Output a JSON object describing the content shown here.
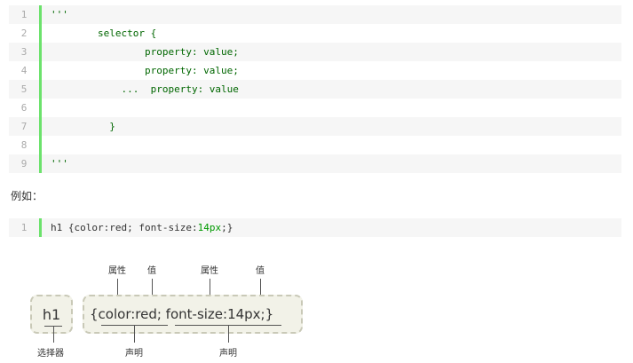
{
  "code_block_1": {
    "lines": [
      {
        "num": "1",
        "text": "'''"
      },
      {
        "num": "2",
        "text": "        selector {"
      },
      {
        "num": "3",
        "text": "                property: value;"
      },
      {
        "num": "4",
        "text": "                property: value;"
      },
      {
        "num": "5",
        "text": "            ...  property: value"
      },
      {
        "num": "6",
        "text": ""
      },
      {
        "num": "7",
        "text": "          }"
      },
      {
        "num": "8",
        "text": ""
      },
      {
        "num": "9",
        "text": "'''"
      }
    ]
  },
  "example_label": "例如：",
  "code_block_2": {
    "line_num": "1",
    "prefix": "h1 {color:red; font-size:",
    "number": "14px",
    "suffix": ";}"
  },
  "diagram": {
    "selector_box": "h1",
    "declaration_box": "{color:red; font-size:14px;}",
    "label_property_1": "属性",
    "label_value_1": "值",
    "label_property_2": "属性",
    "label_value_2": "值",
    "label_selector": "选择器",
    "label_declaration_1": "声明",
    "label_declaration_2": "声明"
  }
}
